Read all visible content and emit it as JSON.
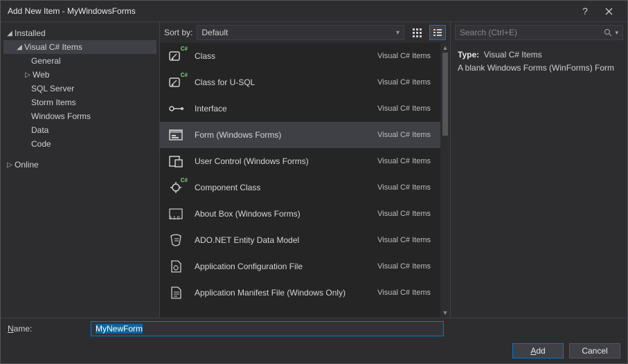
{
  "titlebar": {
    "title": "Add New Item - MyWindowsForms"
  },
  "tree": {
    "installed": "Installed",
    "csitems": "Visual C# Items",
    "children": [
      "General",
      "Web",
      "SQL Server",
      "Storm Items",
      "Windows Forms",
      "Data",
      "Code"
    ],
    "web_has_children": true,
    "online": "Online"
  },
  "toolbar": {
    "sort_label": "Sort by:",
    "sort_value": "Default"
  },
  "items": [
    {
      "name": "Class",
      "category": "Visual C# Items",
      "icon": "class"
    },
    {
      "name": "Class for U-SQL",
      "category": "Visual C# Items",
      "icon": "class"
    },
    {
      "name": "Interface",
      "category": "Visual C# Items",
      "icon": "interface"
    },
    {
      "name": "Form (Windows Forms)",
      "category": "Visual C# Items",
      "icon": "form",
      "selected": true
    },
    {
      "name": "User Control (Windows Forms)",
      "category": "Visual C# Items",
      "icon": "usercontrol"
    },
    {
      "name": "Component Class",
      "category": "Visual C# Items",
      "icon": "component"
    },
    {
      "name": "About Box (Windows Forms)",
      "category": "Visual C# Items",
      "icon": "about"
    },
    {
      "name": "ADO.NET Entity Data Model",
      "category": "Visual C# Items",
      "icon": "ado"
    },
    {
      "name": "Application Configuration File",
      "category": "Visual C# Items",
      "icon": "config"
    },
    {
      "name": "Application Manifest File (Windows Only)",
      "category": "Visual C# Items",
      "icon": "manifest"
    }
  ],
  "search": {
    "placeholder": "Search (Ctrl+E)"
  },
  "info": {
    "type_label": "Type:",
    "type_value": "Visual C# Items",
    "description": "A blank Windows Forms (WinForms) Form"
  },
  "name_bar": {
    "label": "Name:",
    "value": "MyNewForm"
  },
  "buttons": {
    "add": "Add",
    "cancel": "Cancel"
  }
}
